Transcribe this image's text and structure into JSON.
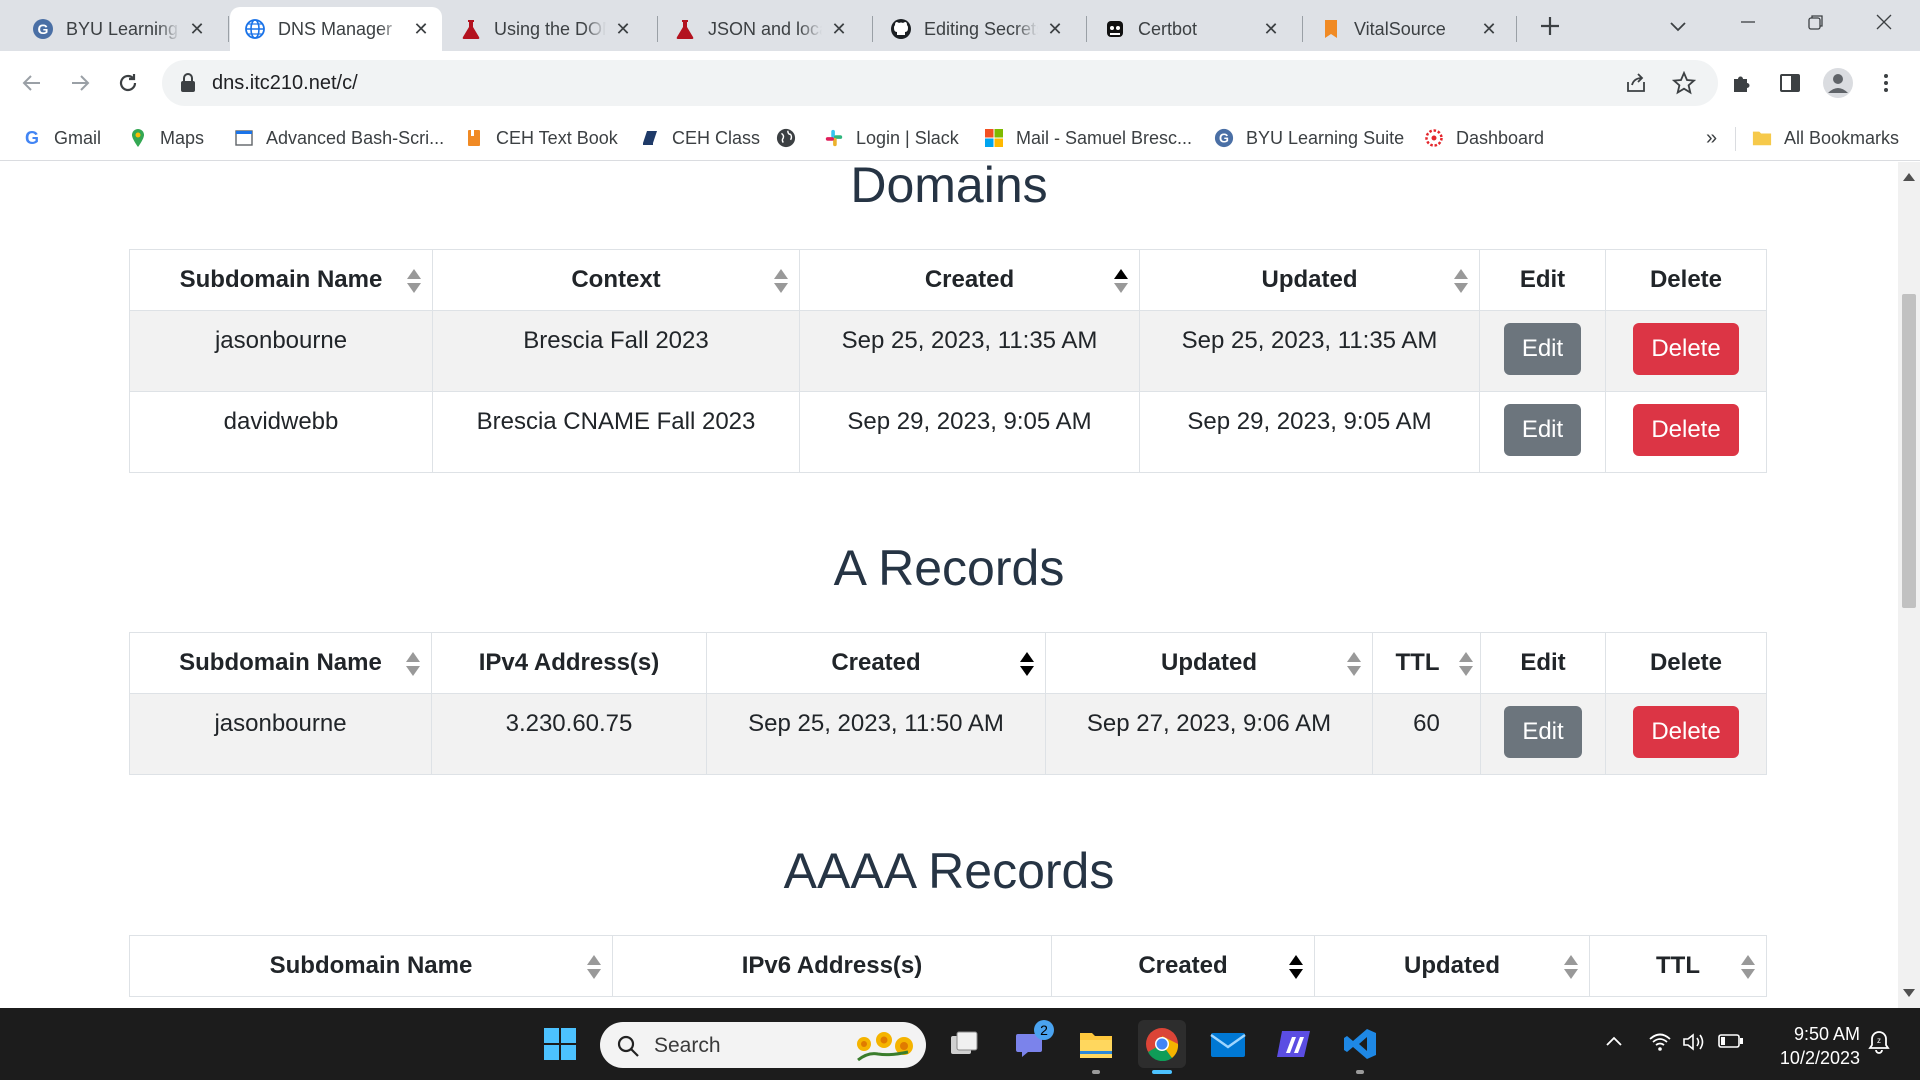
{
  "browser": {
    "tabs": [
      {
        "title": "BYU Learning Suite",
        "icon": "byu-learning-suite-icon",
        "active": false
      },
      {
        "title": "DNS Manager",
        "icon": "globe-icon",
        "active": true
      },
      {
        "title": "Using the DOM",
        "icon": "flask-icon",
        "active": false
      },
      {
        "title": "JSON and local storage",
        "icon": "flask-icon",
        "active": false
      },
      {
        "title": "Editing Secrets",
        "icon": "github-icon",
        "active": false
      },
      {
        "title": "Certbot",
        "icon": "certbot-icon",
        "active": false
      },
      {
        "title": "VitalSource",
        "icon": "vitalsource-icon",
        "active": false
      }
    ],
    "url": "dns.itc210.net/c/",
    "bookmarks": [
      {
        "label": "Gmail",
        "icon": "google-icon"
      },
      {
        "label": "Maps",
        "icon": "maps-pin-icon"
      },
      {
        "label": "Advanced Bash-Scri...",
        "icon": "page-icon"
      },
      {
        "label": "CEH Text Book",
        "icon": "book-icon"
      },
      {
        "label": "CEH Class",
        "icon": "book-icon"
      },
      {
        "label": "",
        "icon": "globe-dark-icon"
      },
      {
        "label": "Login | Slack",
        "icon": "slack-icon"
      },
      {
        "label": "Mail - Samuel Bresc...",
        "icon": "microsoft-icon"
      },
      {
        "label": "BYU Learning Suite",
        "icon": "byu-learning-suite-icon"
      },
      {
        "label": "Dashboard",
        "icon": "canvas-icon"
      }
    ],
    "bookmarks_overflow": "»",
    "all_bookmarks": "All Bookmarks"
  },
  "domains": {
    "title": "Domains",
    "headers": [
      "Subdomain Name",
      "Context",
      "Created",
      "Updated",
      "Edit",
      "Delete"
    ],
    "rows": [
      {
        "name": "jasonbourne",
        "context": "Brescia Fall 2023",
        "created": "Sep 25, 2023, 11:35 AM",
        "updated": "Sep 25, 2023, 11:35 AM",
        "edit": "Edit",
        "delete": "Delete"
      },
      {
        "name": "davidwebb",
        "context": "Brescia CNAME Fall 2023",
        "created": "Sep 29, 2023, 9:05 AM",
        "updated": "Sep 29, 2023, 9:05 AM",
        "edit": "Edit",
        "delete": "Delete"
      }
    ]
  },
  "a_records": {
    "title": "A Records",
    "headers": [
      "Subdomain Name",
      "IPv4 Address(s)",
      "Created",
      "Updated",
      "TTL",
      "Edit",
      "Delete"
    ],
    "rows": [
      {
        "name": "jasonbourne",
        "ip": "3.230.60.75",
        "created": "Sep 25, 2023, 11:50 AM",
        "updated": "Sep 27, 2023, 9:06 AM",
        "ttl": "60",
        "edit": "Edit",
        "delete": "Delete"
      }
    ]
  },
  "aaaa_records": {
    "title": "AAAA Records",
    "headers": [
      "Subdomain Name",
      "IPv6 Address(s)",
      "Created",
      "Updated",
      "TTL"
    ]
  },
  "taskbar": {
    "search_placeholder": "Search",
    "teams_badge": "2",
    "time": "9:50 AM",
    "date": "10/2/2023"
  },
  "colors": {
    "edit_button": "#6c757d",
    "delete_button": "#dc3545",
    "heading": "#263444"
  }
}
